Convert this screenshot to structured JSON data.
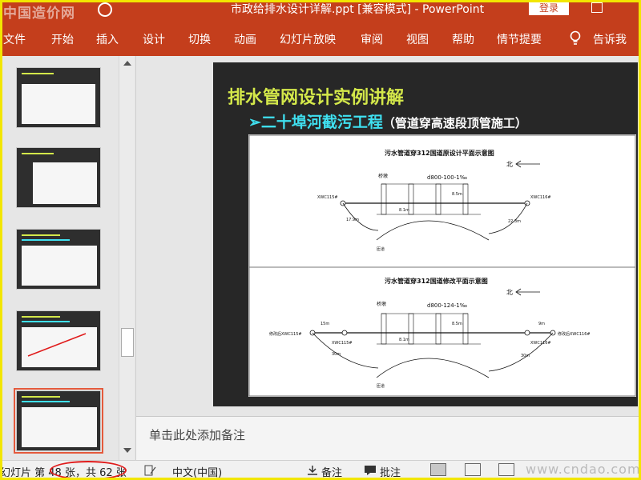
{
  "titlebar": {
    "watermark": "中国造价网",
    "title": "市政给排水设计详解.ppt [兼容模式] - PowerPoint",
    "login": "登录"
  },
  "ribbon": {
    "tabs": [
      "文件",
      "开始",
      "插入",
      "设计",
      "切换",
      "动画",
      "幻灯片放映",
      "审阅",
      "视图",
      "帮助",
      "情节提要",
      "告诉我"
    ]
  },
  "thumbnails": [
    {
      "label": "排水管网设计",
      "sub": "管道设计"
    },
    {
      "label": "排水管网设计",
      "sub": "排水检查井"
    },
    {
      "label": "排水管网设计实例讲解",
      "sub": "天虹河截污治理工程"
    },
    {
      "label": "排水管网设计实例讲解",
      "sub": "二十埠河截污工程"
    },
    {
      "label": "排水管网设计实例讲解",
      "sub": "二十埠河截污工程"
    }
  ],
  "slide": {
    "title": "排水管网设计实例讲解",
    "bullet": "➢二十埠河截污工程",
    "bullet_note": "（管道穿高速段顶管施工）",
    "figure": {
      "top_title": "污水管道穿312国道原设计平面示意图",
      "bottom_title": "污水管道穿312国道修改平面示意图",
      "north": "北",
      "top_pipe": "d800-100-1‰",
      "bottom_pipe": "d800-124-1‰",
      "well_left": "XWC115#",
      "well_right": "XWC116#",
      "well_left_mod": "修改后XWC115#",
      "well_right_mod": "修改后XWC116#",
      "bridge": "桥墩",
      "ramp": "匝道",
      "dim_15m": "15m",
      "dim_9m": "9m",
      "dim_17m": "17.9m",
      "dim_22m": "22.3m",
      "dim_30m": "30m",
      "dim_8m": "8.1m",
      "dim_85m": "8.5m"
    }
  },
  "notes": {
    "placeholder": "单击此处添加备注"
  },
  "status": {
    "slide_counter": "幻灯片 第 48 张，共 62 张",
    "language": "中文(中国)",
    "notes_btn": "备注",
    "comments_btn": "批注",
    "watermark": "www.cndao.com"
  },
  "colors": {
    "ribbon": "#c43e1c",
    "slide_title": "#d4e84a",
    "slide_bullet": "#3fe0f0",
    "highlight_circle": "#e01b1b"
  }
}
